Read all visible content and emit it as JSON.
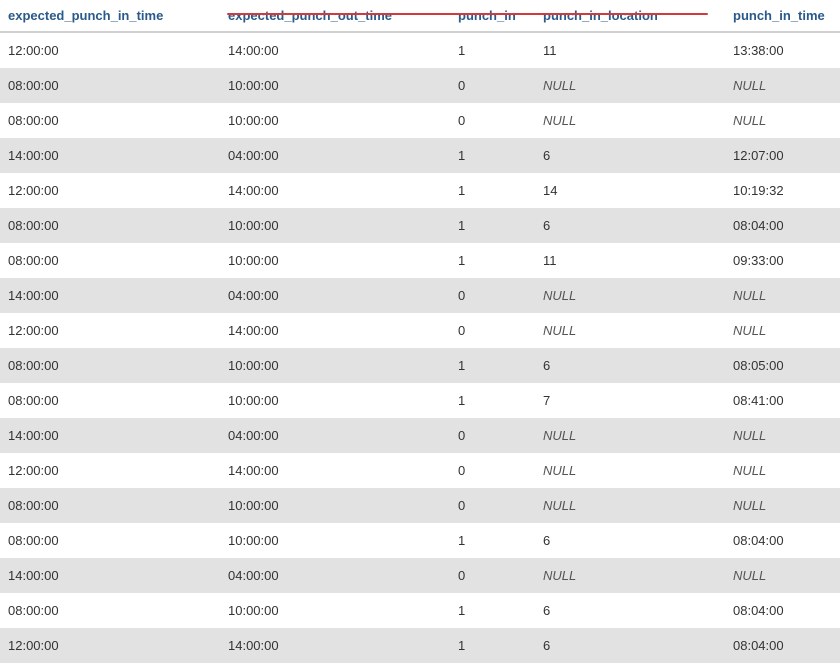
{
  "columns": [
    "expected_punch_in_time",
    "expected_punch_out_time",
    "punch_in",
    "punch_in_location",
    "punch_in_time"
  ],
  "null_label": "NULL",
  "rows": [
    {
      "expected_punch_in_time": "12:00:00",
      "expected_punch_out_time": "14:00:00",
      "punch_in": "1",
      "punch_in_location": "11",
      "punch_in_time": "13:38:00"
    },
    {
      "expected_punch_in_time": "08:00:00",
      "expected_punch_out_time": "10:00:00",
      "punch_in": "0",
      "punch_in_location": null,
      "punch_in_time": null
    },
    {
      "expected_punch_in_time": "08:00:00",
      "expected_punch_out_time": "10:00:00",
      "punch_in": "0",
      "punch_in_location": null,
      "punch_in_time": null
    },
    {
      "expected_punch_in_time": "14:00:00",
      "expected_punch_out_time": "04:00:00",
      "punch_in": "1",
      "punch_in_location": "6",
      "punch_in_time": "12:07:00"
    },
    {
      "expected_punch_in_time": "12:00:00",
      "expected_punch_out_time": "14:00:00",
      "punch_in": "1",
      "punch_in_location": "14",
      "punch_in_time": "10:19:32"
    },
    {
      "expected_punch_in_time": "08:00:00",
      "expected_punch_out_time": "10:00:00",
      "punch_in": "1",
      "punch_in_location": "6",
      "punch_in_time": "08:04:00"
    },
    {
      "expected_punch_in_time": "08:00:00",
      "expected_punch_out_time": "10:00:00",
      "punch_in": "1",
      "punch_in_location": "11",
      "punch_in_time": "09:33:00"
    },
    {
      "expected_punch_in_time": "14:00:00",
      "expected_punch_out_time": "04:00:00",
      "punch_in": "0",
      "punch_in_location": null,
      "punch_in_time": null
    },
    {
      "expected_punch_in_time": "12:00:00",
      "expected_punch_out_time": "14:00:00",
      "punch_in": "0",
      "punch_in_location": null,
      "punch_in_time": null
    },
    {
      "expected_punch_in_time": "08:00:00",
      "expected_punch_out_time": "10:00:00",
      "punch_in": "1",
      "punch_in_location": "6",
      "punch_in_time": "08:05:00"
    },
    {
      "expected_punch_in_time": "08:00:00",
      "expected_punch_out_time": "10:00:00",
      "punch_in": "1",
      "punch_in_location": "7",
      "punch_in_time": "08:41:00"
    },
    {
      "expected_punch_in_time": "14:00:00",
      "expected_punch_out_time": "04:00:00",
      "punch_in": "0",
      "punch_in_location": null,
      "punch_in_time": null
    },
    {
      "expected_punch_in_time": "12:00:00",
      "expected_punch_out_time": "14:00:00",
      "punch_in": "0",
      "punch_in_location": null,
      "punch_in_time": null
    },
    {
      "expected_punch_in_time": "08:00:00",
      "expected_punch_out_time": "10:00:00",
      "punch_in": "0",
      "punch_in_location": null,
      "punch_in_time": null
    },
    {
      "expected_punch_in_time": "08:00:00",
      "expected_punch_out_time": "10:00:00",
      "punch_in": "1",
      "punch_in_location": "6",
      "punch_in_time": "08:04:00"
    },
    {
      "expected_punch_in_time": "14:00:00",
      "expected_punch_out_time": "04:00:00",
      "punch_in": "0",
      "punch_in_location": null,
      "punch_in_time": null
    },
    {
      "expected_punch_in_time": "08:00:00",
      "expected_punch_out_time": "10:00:00",
      "punch_in": "1",
      "punch_in_location": "6",
      "punch_in_time": "08:04:00"
    },
    {
      "expected_punch_in_time": "12:00:00",
      "expected_punch_out_time": "14:00:00",
      "punch_in": "1",
      "punch_in_location": "6",
      "punch_in_time": "08:04:00"
    }
  ],
  "annotation": {
    "kind": "strike-line",
    "color": "#d23b3b"
  }
}
